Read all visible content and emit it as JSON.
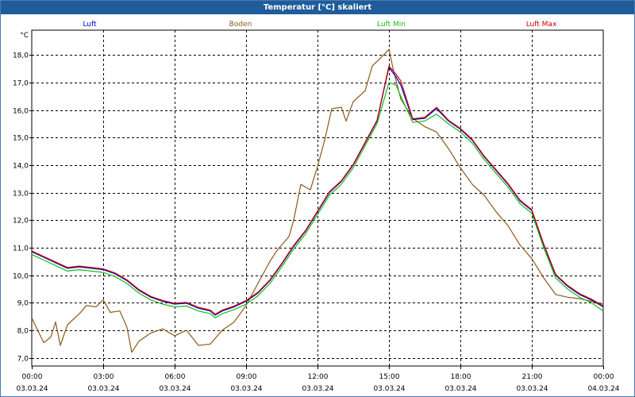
{
  "window": {
    "title": "Temperatur [°C] skaliert"
  },
  "chart_data": {
    "type": "line",
    "ylabel": "°C",
    "ylim": [
      6.7,
      18.9
    ],
    "yticks": [
      7.0,
      8.0,
      9.0,
      10.0,
      11.0,
      12.0,
      13.0,
      14.0,
      15.0,
      16.0,
      17.0,
      18.0
    ],
    "ytick_labels": [
      "7,0",
      "8,0",
      "9,0",
      "10,0",
      "11,0",
      "12,0",
      "13,0",
      "14,0",
      "15,0",
      "16,0",
      "17,0",
      "18,0"
    ],
    "xlim": [
      0,
      24
    ],
    "xticks": [
      {
        "h": 0,
        "time": "00:00",
        "date": "03.03.24"
      },
      {
        "h": 3,
        "time": "03:00",
        "date": "03.03.24"
      },
      {
        "h": 6,
        "time": "06:00",
        "date": "03.03.24"
      },
      {
        "h": 9,
        "time": "09:00",
        "date": "03.03.24"
      },
      {
        "h": 12,
        "time": "12:00",
        "date": "03.03.24"
      },
      {
        "h": 15,
        "time": "15:00",
        "date": "03.03.24"
      },
      {
        "h": 18,
        "time": "18:00",
        "date": "03.03.24"
      },
      {
        "h": 21,
        "time": "21:00",
        "date": "03.03.24"
      },
      {
        "h": 24,
        "time": "00:00",
        "date": "04.03.24"
      }
    ],
    "grid": true,
    "legend_position": "top",
    "series": [
      {
        "name": "Luft",
        "color": "#0000cc",
        "points": [
          [
            0,
            10.85
          ],
          [
            0.5,
            10.65
          ],
          [
            1,
            10.45
          ],
          [
            1.5,
            10.25
          ],
          [
            2,
            10.3
          ],
          [
            2.5,
            10.25
          ],
          [
            3,
            10.2
          ],
          [
            3.5,
            10.05
          ],
          [
            4,
            9.8
          ],
          [
            4.5,
            9.45
          ],
          [
            5,
            9.2
          ],
          [
            5.5,
            9.05
          ],
          [
            6,
            8.95
          ],
          [
            6.5,
            8.98
          ],
          [
            7,
            8.8
          ],
          [
            7.5,
            8.7
          ],
          [
            7.7,
            8.55
          ],
          [
            8,
            8.7
          ],
          [
            8.5,
            8.85
          ],
          [
            9,
            9.05
          ],
          [
            9.5,
            9.35
          ],
          [
            10,
            9.8
          ],
          [
            10.5,
            10.4
          ],
          [
            11,
            11.05
          ],
          [
            11.5,
            11.6
          ],
          [
            12,
            12.3
          ],
          [
            12.5,
            13.0
          ],
          [
            13,
            13.4
          ],
          [
            13.5,
            14.0
          ],
          [
            14,
            14.8
          ],
          [
            14.5,
            15.6
          ],
          [
            15,
            17.55
          ],
          [
            15.3,
            17.2
          ],
          [
            15.5,
            16.9
          ],
          [
            16,
            15.65
          ],
          [
            16.5,
            15.7
          ],
          [
            17,
            16.05
          ],
          [
            17.5,
            15.6
          ],
          [
            18,
            15.3
          ],
          [
            18.5,
            14.9
          ],
          [
            19,
            14.3
          ],
          [
            19.5,
            13.8
          ],
          [
            20,
            13.3
          ],
          [
            20.5,
            12.7
          ],
          [
            21,
            12.35
          ],
          [
            21.5,
            11.1
          ],
          [
            22,
            10.0
          ],
          [
            22.5,
            9.6
          ],
          [
            23,
            9.3
          ],
          [
            23.5,
            9.1
          ],
          [
            24,
            8.85
          ]
        ]
      },
      {
        "name": "Boden",
        "color": "#8b5a1a",
        "points": [
          [
            0,
            8.45
          ],
          [
            0.5,
            7.55
          ],
          [
            0.8,
            7.75
          ],
          [
            1,
            8.3
          ],
          [
            1.2,
            7.45
          ],
          [
            1.5,
            8.2
          ],
          [
            2,
            8.6
          ],
          [
            2.3,
            8.9
          ],
          [
            2.7,
            8.85
          ],
          [
            3,
            9.1
          ],
          [
            3.3,
            8.65
          ],
          [
            3.7,
            8.7
          ],
          [
            4,
            8.1
          ],
          [
            4.2,
            7.2
          ],
          [
            4.5,
            7.6
          ],
          [
            5,
            7.9
          ],
          [
            5.5,
            8.05
          ],
          [
            6,
            7.8
          ],
          [
            6.5,
            8.0
          ],
          [
            7,
            7.45
          ],
          [
            7.5,
            7.5
          ],
          [
            8,
            8.0
          ],
          [
            8.5,
            8.3
          ],
          [
            9,
            8.9
          ],
          [
            9.5,
            9.7
          ],
          [
            10,
            10.5
          ],
          [
            10.3,
            10.9
          ],
          [
            10.8,
            11.4
          ],
          [
            11,
            12.0
          ],
          [
            11.3,
            13.3
          ],
          [
            11.7,
            13.1
          ],
          [
            12,
            13.95
          ],
          [
            12.3,
            14.9
          ],
          [
            12.6,
            16.05
          ],
          [
            13,
            16.1
          ],
          [
            13.2,
            15.6
          ],
          [
            13.5,
            16.3
          ],
          [
            14,
            16.7
          ],
          [
            14.3,
            17.6
          ],
          [
            14.6,
            17.85
          ],
          [
            15,
            18.2
          ],
          [
            15.2,
            17.4
          ],
          [
            15.5,
            16.4
          ],
          [
            16,
            15.7
          ],
          [
            16.5,
            15.4
          ],
          [
            17,
            15.2
          ],
          [
            17.5,
            14.6
          ],
          [
            18,
            13.9
          ],
          [
            18.5,
            13.3
          ],
          [
            19,
            12.9
          ],
          [
            19.5,
            12.3
          ],
          [
            20,
            11.8
          ],
          [
            20.5,
            11.1
          ],
          [
            21,
            10.6
          ],
          [
            21.5,
            9.9
          ],
          [
            22,
            9.3
          ],
          [
            22.5,
            9.2
          ],
          [
            23,
            9.15
          ],
          [
            23.5,
            9.05
          ],
          [
            24,
            8.95
          ]
        ]
      },
      {
        "name": "Luft Min",
        "color": "#10c010",
        "points": [
          [
            0,
            10.75
          ],
          [
            0.5,
            10.55
          ],
          [
            1,
            10.35
          ],
          [
            1.5,
            10.15
          ],
          [
            2,
            10.2
          ],
          [
            2.5,
            10.15
          ],
          [
            3,
            10.1
          ],
          [
            3.5,
            9.95
          ],
          [
            4,
            9.7
          ],
          [
            4.5,
            9.35
          ],
          [
            5,
            9.1
          ],
          [
            5.5,
            8.95
          ],
          [
            6,
            8.85
          ],
          [
            6.5,
            8.88
          ],
          [
            7,
            8.7
          ],
          [
            7.5,
            8.6
          ],
          [
            7.7,
            8.45
          ],
          [
            8,
            8.6
          ],
          [
            8.5,
            8.75
          ],
          [
            9,
            8.95
          ],
          [
            9.5,
            9.25
          ],
          [
            10,
            9.7
          ],
          [
            10.5,
            10.3
          ],
          [
            11,
            10.95
          ],
          [
            11.5,
            11.5
          ],
          [
            12,
            12.2
          ],
          [
            12.5,
            12.9
          ],
          [
            13,
            13.3
          ],
          [
            13.5,
            13.9
          ],
          [
            14,
            14.7
          ],
          [
            14.5,
            15.5
          ],
          [
            15,
            17.0
          ],
          [
            15.3,
            16.9
          ],
          [
            15.5,
            16.5
          ],
          [
            16,
            15.55
          ],
          [
            16.5,
            15.6
          ],
          [
            17,
            15.85
          ],
          [
            17.5,
            15.5
          ],
          [
            18,
            15.2
          ],
          [
            18.5,
            14.8
          ],
          [
            19,
            14.2
          ],
          [
            19.5,
            13.7
          ],
          [
            20,
            13.2
          ],
          [
            20.5,
            12.6
          ],
          [
            21,
            12.25
          ],
          [
            21.5,
            11.0
          ],
          [
            22,
            9.9
          ],
          [
            22.5,
            9.5
          ],
          [
            23,
            9.2
          ],
          [
            23.5,
            9.0
          ],
          [
            24,
            8.7
          ]
        ]
      },
      {
        "name": "Luft Max",
        "color": "#d00000",
        "points": [
          [
            0,
            10.88
          ],
          [
            0.5,
            10.68
          ],
          [
            1,
            10.48
          ],
          [
            1.5,
            10.28
          ],
          [
            2,
            10.33
          ],
          [
            2.5,
            10.28
          ],
          [
            3,
            10.23
          ],
          [
            3.5,
            10.08
          ],
          [
            4,
            9.83
          ],
          [
            4.5,
            9.48
          ],
          [
            5,
            9.23
          ],
          [
            5.5,
            9.08
          ],
          [
            6,
            8.98
          ],
          [
            6.5,
            9.01
          ],
          [
            7,
            8.83
          ],
          [
            7.5,
            8.73
          ],
          [
            7.7,
            8.58
          ],
          [
            8,
            8.73
          ],
          [
            8.5,
            8.88
          ],
          [
            9,
            9.08
          ],
          [
            9.5,
            9.38
          ],
          [
            10,
            9.83
          ],
          [
            10.5,
            10.43
          ],
          [
            11,
            11.08
          ],
          [
            11.5,
            11.63
          ],
          [
            12,
            12.33
          ],
          [
            12.5,
            13.03
          ],
          [
            13,
            13.43
          ],
          [
            13.5,
            14.03
          ],
          [
            14,
            14.83
          ],
          [
            14.5,
            15.63
          ],
          [
            15,
            17.6
          ],
          [
            15.3,
            17.3
          ],
          [
            15.5,
            17.05
          ],
          [
            16,
            15.68
          ],
          [
            16.5,
            15.73
          ],
          [
            17,
            16.1
          ],
          [
            17.5,
            15.63
          ],
          [
            18,
            15.33
          ],
          [
            18.5,
            14.93
          ],
          [
            19,
            14.33
          ],
          [
            19.5,
            13.83
          ],
          [
            20,
            13.33
          ],
          [
            20.5,
            12.73
          ],
          [
            21,
            12.38
          ],
          [
            21.5,
            11.13
          ],
          [
            22,
            10.03
          ],
          [
            22.5,
            9.63
          ],
          [
            23,
            9.33
          ],
          [
            23.5,
            9.13
          ],
          [
            24,
            8.88
          ]
        ]
      }
    ]
  }
}
